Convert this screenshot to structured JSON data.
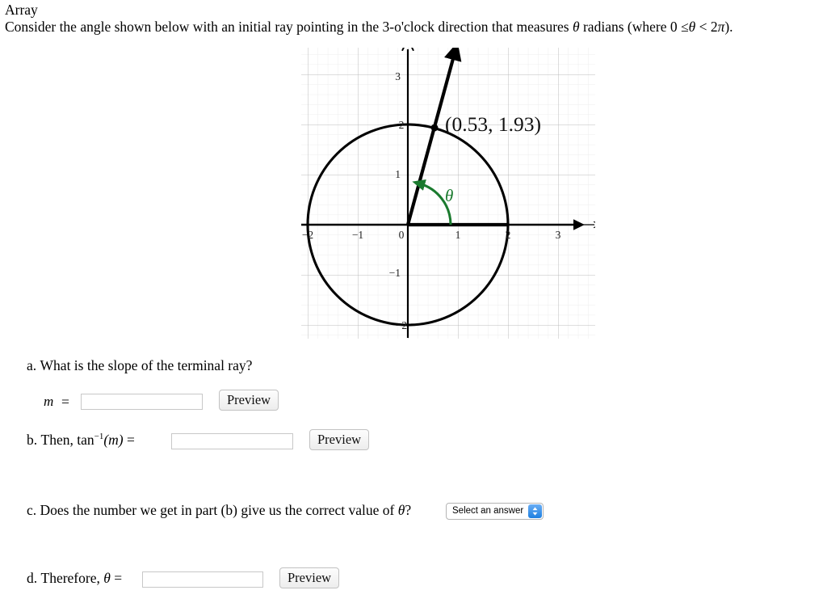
{
  "header": {
    "array_label": "Array",
    "prompt_part1": "Consider the angle shown below with an initial ray pointing in the 3-o'clock direction that measures ",
    "prompt_theta": "θ",
    "prompt_part2": " radians (where 0 ",
    "prompt_le": "≤",
    "prompt_theta2": "θ",
    "prompt_lt": " < 2",
    "prompt_pi": "π",
    "prompt_end": ")."
  },
  "chart_data": {
    "type": "scatter",
    "title": "",
    "xlabel": "",
    "ylabel": "",
    "xlim": [
      -2.15,
      3.75
    ],
    "ylim": [
      -2.6,
      3.5
    ],
    "grid": true,
    "major_grid_step": 1,
    "minor_grid_step": 0.2,
    "x_ticks": [
      -2,
      -1,
      0,
      1,
      2,
      3
    ],
    "x_tick_labels": [
      "−2",
      "−1",
      "0",
      "1",
      "2",
      "3"
    ],
    "y_ticks": [
      -2,
      -1,
      1,
      2,
      3
    ],
    "y_tick_labels": [
      "−2",
      "−1",
      "1",
      "2",
      "3"
    ],
    "circle": {
      "center": [
        0,
        0
      ],
      "radius": 2
    },
    "point": {
      "x": 0.53,
      "y": 1.93,
      "label": "(0.53, 1.93)"
    },
    "terminal_ray": {
      "from": [
        0,
        0
      ],
      "to": [
        0.925,
        3.37
      ],
      "arrow": true
    },
    "initial_ray": {
      "from": [
        0,
        0
      ],
      "to": [
        2,
        0
      ]
    },
    "angle_arc": {
      "label": "θ",
      "radius": 0.85,
      "start_deg": 0,
      "end_deg": 74.6,
      "color": "#1a7a2e"
    },
    "colors": {
      "curve": "#000000",
      "grid_major": "#b8b8b8",
      "grid_minor": "#ececec",
      "axis": "#000000",
      "angle": "#1a7a2e"
    }
  },
  "questions": [
    {
      "id": "a",
      "label_prefix": "a.",
      "text": "What is the slope of the terminal ray?",
      "var_label": "m",
      "equals": "=",
      "input_value": "",
      "input_placeholder": "",
      "button_label": "Preview"
    },
    {
      "id": "b",
      "label_prefix": "b.",
      "text_lead": "Then, ",
      "fn_name": "tan",
      "fn_exp": "−1",
      "fn_arg": "(m)",
      "equals": "=",
      "input_value": "",
      "input_placeholder": "",
      "button_label": "Preview"
    },
    {
      "id": "c",
      "label_prefix": "c.",
      "text": "Does the number we get in part (b) give us the correct value of ",
      "theta": "θ",
      "text_end": "?",
      "select_value": "Select an answer",
      "select_options": [
        "Select an answer"
      ]
    },
    {
      "id": "d",
      "label_prefix": "d.",
      "text_lead": "Therefore, ",
      "theta": "θ",
      "equals": "=",
      "input_value": "",
      "input_placeholder": "",
      "button_label": "Preview"
    }
  ]
}
